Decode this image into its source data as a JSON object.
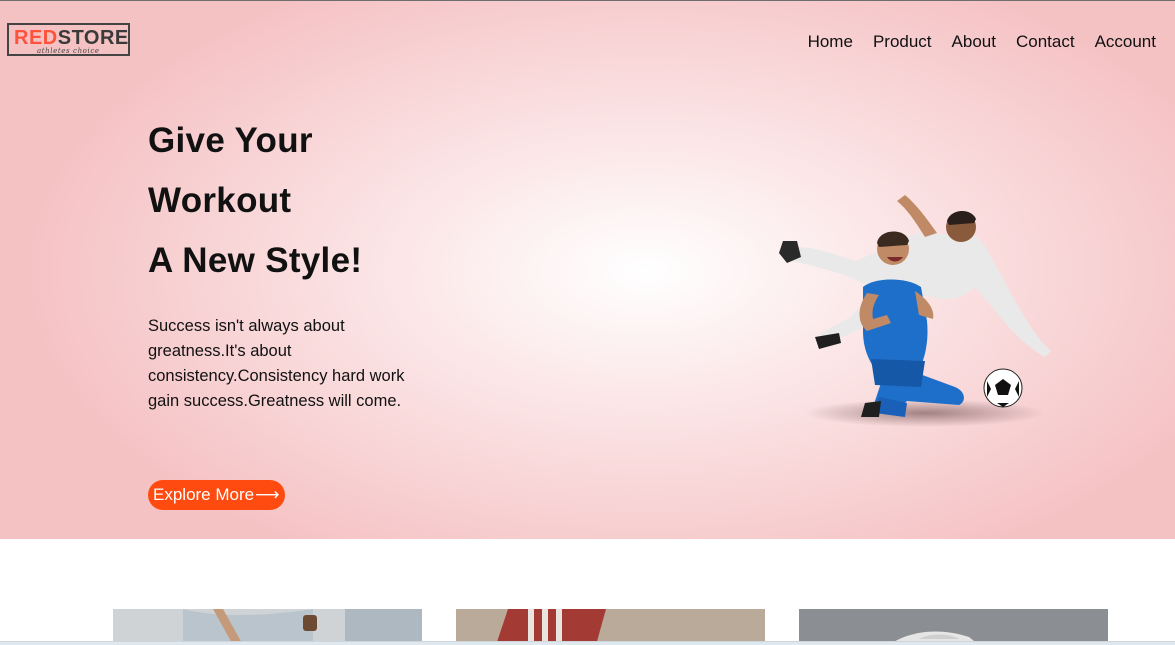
{
  "header": {
    "logo_part1": "RED",
    "logo_part2": "STORE",
    "logo_tagline": "athletes choice"
  },
  "nav": {
    "items": [
      "Home",
      "Product",
      "About",
      "Contact",
      "Account"
    ]
  },
  "hero": {
    "headline": [
      "Give Your",
      "Workout",
      "A New Style!"
    ],
    "subtext": [
      "Success isn't always about",
      "greatness.It's about",
      "consistency.Consistency hard work",
      "gain success.Greatness will come."
    ],
    "cta_label": "Explore More",
    "cta_arrow": "⟶"
  },
  "colors": {
    "brand_red": "#ff523b",
    "cta_orange": "#ff4b0f",
    "hero_pink": "#f5c2c4"
  },
  "icons": {
    "hero_image": "football-players-image"
  }
}
